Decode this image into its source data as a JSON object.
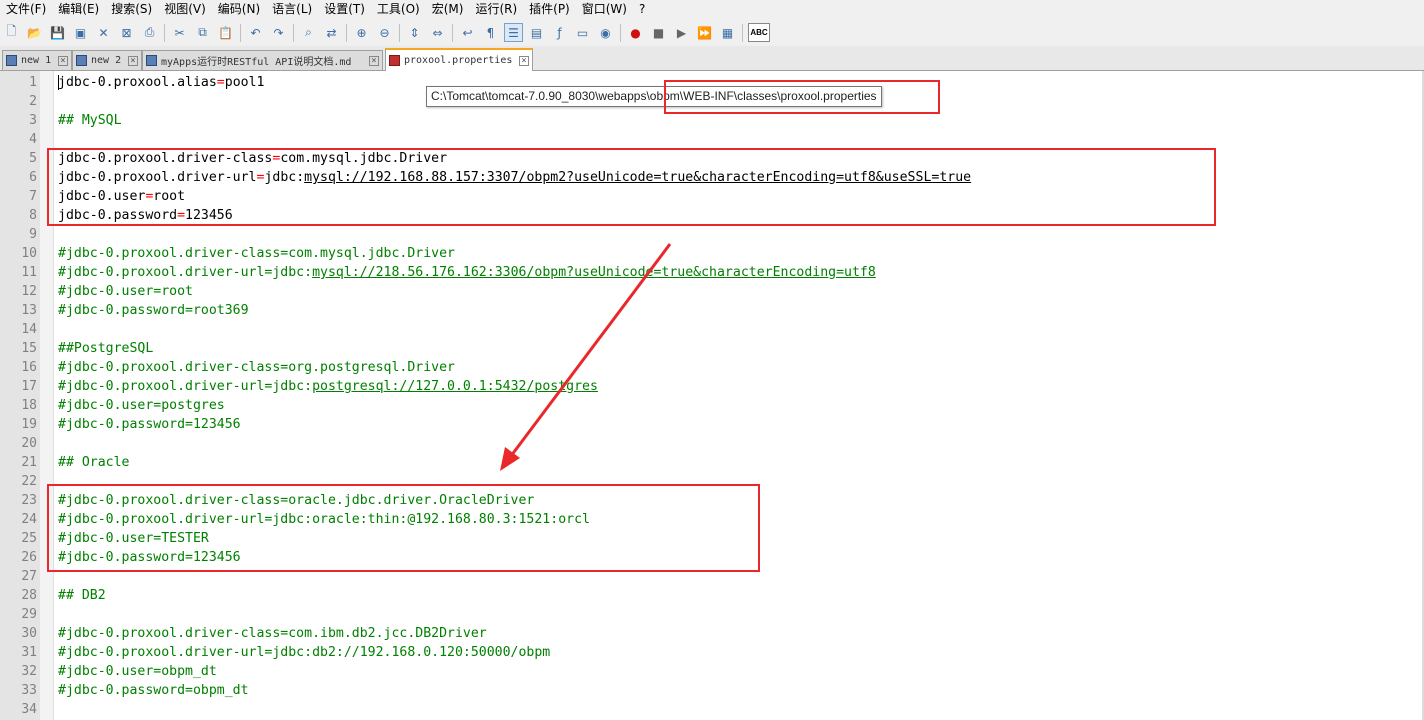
{
  "menu": [
    "文件(F)",
    "编辑(E)",
    "搜索(S)",
    "视图(V)",
    "编码(N)",
    "语言(L)",
    "设置(T)",
    "工具(O)",
    "宏(M)",
    "运行(R)",
    "插件(P)",
    "窗口(W)",
    "?"
  ],
  "toolbar": {
    "icons": [
      "new-file-icon",
      "open-file-icon",
      "save-icon",
      "save-all-icon",
      "close-icon",
      "close-all-icon",
      "print-icon",
      "|",
      "cut-icon",
      "copy-icon",
      "paste-icon",
      "|",
      "undo-icon",
      "redo-icon",
      "|",
      "find-icon",
      "replace-icon",
      "|",
      "zoom-in-icon",
      "zoom-out-icon",
      "|",
      "sync-vertical-icon",
      "sync-horizontal-icon",
      "|",
      "wrap-icon",
      "show-all-chars-icon",
      "indent-guide-icon",
      "doc-map-icon",
      "function-list-icon",
      "folder-workspace-icon",
      "monitor-icon",
      "|",
      "record-macro-icon",
      "stop-macro-icon",
      "play-macro-icon",
      "run-macro-multiple-icon",
      "save-macro-icon",
      "|",
      "spellcheck-icon"
    ],
    "spellcheck_label": "ABC"
  },
  "tabs": [
    {
      "label": "new 1",
      "unsaved": false,
      "active": false
    },
    {
      "label": "new 2",
      "unsaved": false,
      "active": false
    },
    {
      "label": "myApps运行时RESTful API说明文档.md",
      "unsaved": false,
      "active": false
    },
    {
      "label": "proxool.properties",
      "unsaved": true,
      "active": true
    }
  ],
  "tooltip": "C:\\Tomcat\\tomcat-7.0.90_8030\\webapps\\obpm\\WEB-INF\\classes\\proxool.properties",
  "lines": [
    {
      "n": "1",
      "type": "kv",
      "key": "jdbc-0.proxool.alias",
      "eq": "=",
      "val": "pool1"
    },
    {
      "n": "2",
      "type": "blank"
    },
    {
      "n": "3",
      "type": "comment",
      "text": "## MySQL"
    },
    {
      "n": "4",
      "type": "blank"
    },
    {
      "n": "5",
      "type": "kv",
      "key": "jdbc-0.proxool.driver-class",
      "eq": "=",
      "val": "com.mysql.jdbc.Driver"
    },
    {
      "n": "6",
      "type": "kv",
      "key": "jdbc-0.proxool.driver-url",
      "eq": "=",
      "val": "jdbc:",
      "url": "mysql://192.168.88.157:3307/obpm2?useUnicode=true&characterEncoding=utf8&useSSL=true"
    },
    {
      "n": "7",
      "type": "kv",
      "key": "jdbc-0.user",
      "eq": "=",
      "val": "root"
    },
    {
      "n": "8",
      "type": "kv",
      "key": "jdbc-0.password",
      "eq": "=",
      "val": "123456"
    },
    {
      "n": "9",
      "type": "blank"
    },
    {
      "n": "10",
      "type": "comment",
      "text": "#jdbc-0.proxool.driver-class=com.mysql.jdbc.Driver"
    },
    {
      "n": "11",
      "type": "comment",
      "text": "#jdbc-0.proxool.driver-url=jdbc:",
      "url": "mysql://218.56.176.162:3306/obpm?useUnicode=true&characterEncoding=utf8"
    },
    {
      "n": "12",
      "type": "comment",
      "text": "#jdbc-0.user=root"
    },
    {
      "n": "13",
      "type": "comment",
      "text": "#jdbc-0.password=root369"
    },
    {
      "n": "14",
      "type": "blank"
    },
    {
      "n": "15",
      "type": "comment",
      "text": "##PostgreSQL"
    },
    {
      "n": "16",
      "type": "comment",
      "text": "#jdbc-0.proxool.driver-class=org.postgresql.Driver"
    },
    {
      "n": "17",
      "type": "comment",
      "text": "#jdbc-0.proxool.driver-url=jdbc:",
      "url": "postgresql://127.0.0.1:5432/postgres"
    },
    {
      "n": "18",
      "type": "comment",
      "text": "#jdbc-0.user=postgres"
    },
    {
      "n": "19",
      "type": "comment",
      "text": "#jdbc-0.password=123456"
    },
    {
      "n": "20",
      "type": "blank"
    },
    {
      "n": "21",
      "type": "comment",
      "text": "## Oracle"
    },
    {
      "n": "22",
      "type": "blank"
    },
    {
      "n": "23",
      "type": "comment",
      "text": "#jdbc-0.proxool.driver-class=oracle.jdbc.driver.OracleDriver"
    },
    {
      "n": "24",
      "type": "comment",
      "text": "#jdbc-0.proxool.driver-url=jdbc:oracle:thin:@192.168.80.3:1521:orcl"
    },
    {
      "n": "25",
      "type": "comment",
      "text": "#jdbc-0.user=TESTER"
    },
    {
      "n": "26",
      "type": "comment",
      "text": "#jdbc-0.password=123456"
    },
    {
      "n": "27",
      "type": "blank"
    },
    {
      "n": "28",
      "type": "comment",
      "text": "## DB2"
    },
    {
      "n": "29",
      "type": "blank"
    },
    {
      "n": "30",
      "type": "comment",
      "text": "#jdbc-0.proxool.driver-class=com.ibm.db2.jcc.DB2Driver"
    },
    {
      "n": "31",
      "type": "comment",
      "text": "#jdbc-0.proxool.driver-url=jdbc:db2://192.168.0.120:50000/obpm"
    },
    {
      "n": "32",
      "type": "comment",
      "text": "#jdbc-0.user=obpm_dt"
    },
    {
      "n": "33",
      "type": "comment",
      "text": "#jdbc-0.password=obpm_dt"
    },
    {
      "n": "34",
      "type": "blank"
    }
  ],
  "colors": {
    "annotation": "#e8282a",
    "comment": "#008000",
    "operator": "#ff0000",
    "active_tab_accent": "#f5a623"
  }
}
